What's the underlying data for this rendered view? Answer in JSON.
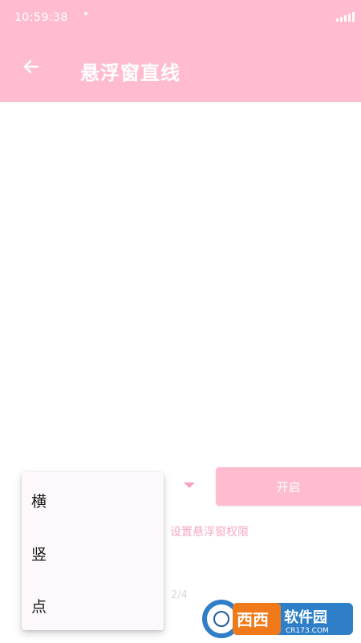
{
  "status_bar": {
    "time": "10:59:38",
    "dot": "•"
  },
  "header": {
    "title": "悬浮窗直线",
    "back_icon": "arrow-left-icon"
  },
  "controls": {
    "spinner_icon": "dropdown-triangle-icon",
    "open_button": "开启",
    "permission_link": "设置悬浮窗权限",
    "pager": "2/4"
  },
  "dropdown": {
    "options": [
      "横",
      "竖",
      "点"
    ]
  },
  "watermark": {
    "brand": "西西",
    "name": "软件园",
    "domain": "CR173.COM"
  },
  "colors": {
    "primary": "#ffbccf",
    "accent": "#f5a8c0"
  }
}
